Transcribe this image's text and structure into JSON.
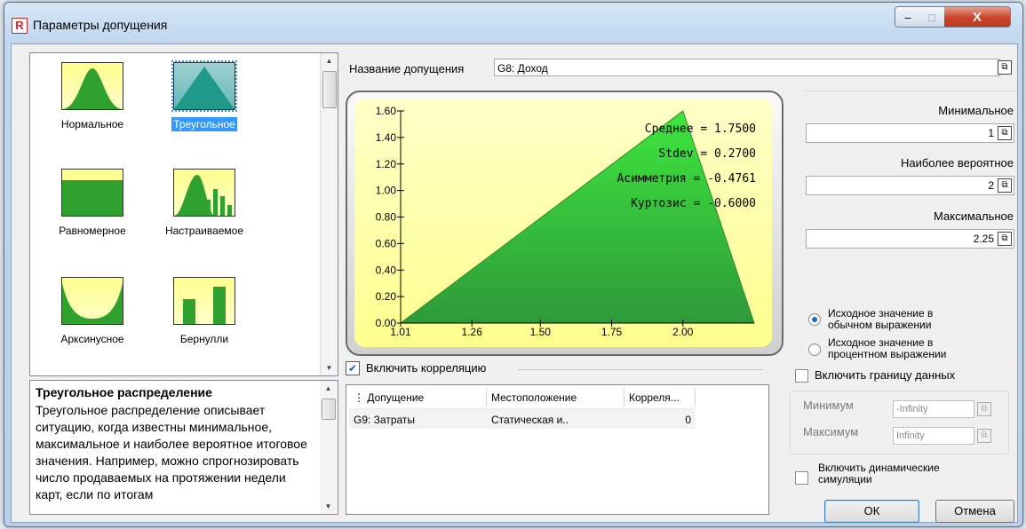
{
  "window": {
    "title": "Параметры допущения",
    "app_icon": "R",
    "close_glyph": "X",
    "min_glyph": "–",
    "max_glyph": "□"
  },
  "gallery": {
    "items": [
      {
        "label": "Нормальное",
        "icon": "normal-distribution-icon"
      },
      {
        "label": "Треугольное",
        "icon": "triangular-distribution-icon",
        "selected": true
      },
      {
        "label": "Равномерное",
        "icon": "uniform-distribution-icon"
      },
      {
        "label": "Настраиваемое",
        "icon": "custom-distribution-icon"
      },
      {
        "label": "Арксинусное",
        "icon": "arcsine-distribution-icon"
      },
      {
        "label": "Бернулли",
        "icon": "bernoulli-distribution-icon"
      }
    ]
  },
  "description": {
    "title": "Треугольное распределение",
    "text": "Треугольное распределение описывает ситуацию, когда известны минимальное, максимальное и наиболее вероятное итоговое значения. Например, можно спрогнозировать число продаваемых на протяжении недели карт, если по итогам"
  },
  "assumption": {
    "name_label": "Название допущения",
    "name_value": "G8: Доход"
  },
  "chart_data": {
    "type": "area",
    "title": "",
    "x": [
      1.0,
      2.0,
      2.25
    ],
    "y": [
      0.0,
      1.6,
      0.0
    ],
    "x_ticks": [
      "1.01",
      "1.26",
      "1.50",
      "1.75",
      "2.00"
    ],
    "y_ticks": [
      "0.00",
      "0.20",
      "0.40",
      "0.60",
      "0.80",
      "1.00",
      "1.20",
      "1.40",
      "1.60"
    ],
    "xlim": [
      1.01,
      2.25
    ],
    "ylim": [
      0.0,
      1.6
    ],
    "stats": [
      {
        "label": "Среднее",
        "value": "1.7500"
      },
      {
        "label": "Stdev",
        "value": "0.2700"
      },
      {
        "label": "Асимметрия",
        "value": "-0.4761"
      },
      {
        "label": "Куртозис",
        "value": "-0.6000"
      }
    ],
    "fill_color": "#3bbf3b",
    "background_colors": [
      "#ffffc8",
      "#ffff8e"
    ]
  },
  "correlation": {
    "enabled": true,
    "checkbox_label": "Включить корреляцию",
    "columns": [
      "Допущение",
      "Местоположение",
      "Корреля..."
    ],
    "rows": [
      {
        "assumption": "G9: Затраты",
        "location": "Статическая и..",
        "correlation": "0"
      }
    ]
  },
  "params": {
    "min_label": "Минимальное",
    "min_value": "1",
    "likely_label": "Наиболее вероятное",
    "likely_value": "2",
    "max_label": "Максимальное",
    "max_value": "2.25"
  },
  "options": {
    "radio_absolute": "Исходное значение в обычном выражении",
    "radio_percent": "Исходное значение в процентном выражении",
    "truncation_label": "Включить границу данных",
    "bounds_min_label": "Минимум",
    "bounds_min_value": "-Infinity",
    "bounds_max_label": "Максимум",
    "bounds_max_value": "Infinity",
    "dynamic_label": "Включить динамические симуляции"
  },
  "buttons": {
    "ok": "ОК",
    "cancel": "Отмена"
  }
}
